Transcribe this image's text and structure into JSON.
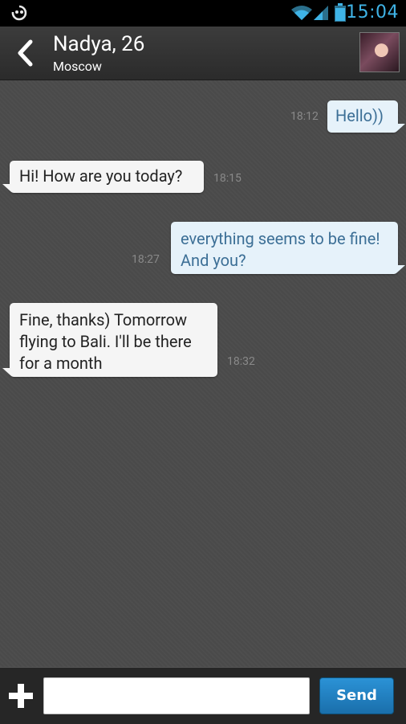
{
  "status_bar": {
    "time": "15:04",
    "accent": "#3fb3e6",
    "icons": [
      "notification-icon",
      "wifi-icon",
      "signal-icon",
      "battery-icon"
    ]
  },
  "header": {
    "title": "Nadya, 26",
    "subtitle": "Moscow",
    "back_icon": "chevron-left-icon",
    "avatar": "profile-avatar"
  },
  "messages": [
    {
      "direction": "outgoing",
      "text": "Hello))",
      "time": "18:12"
    },
    {
      "direction": "incoming",
      "text": "Hi! How are you today?",
      "time": "18:15"
    },
    {
      "direction": "outgoing",
      "text": "everything seems to be fine! And you?",
      "time": "18:27"
    },
    {
      "direction": "incoming",
      "text": "Fine, thanks) Tomorrow flying to Bali. I'll be there for a month",
      "time": "18:32"
    }
  ],
  "composer": {
    "add_icon": "plus-icon",
    "input_value": "",
    "send_label": "Send"
  },
  "colors": {
    "incoming_bubble": "#f5f5f5",
    "outgoing_bubble": "#e6f2fa",
    "outgoing_text": "#3c6f96",
    "send_button": "#1f7dc0"
  }
}
